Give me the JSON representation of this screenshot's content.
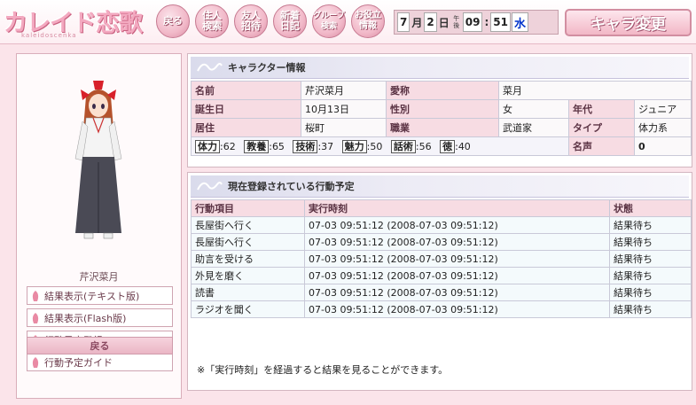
{
  "header": {
    "logo_title": "カレイド恋歌",
    "logo_subtitle": "kaleidoscenka",
    "nav": [
      {
        "label": "戻る"
      },
      {
        "label": "住人\n検索"
      },
      {
        "label": "友人\n招待"
      },
      {
        "label": "新着\n日記"
      },
      {
        "label": "グループ\n検索"
      },
      {
        "label": "お役立\n情報"
      }
    ],
    "clock": {
      "month": "7",
      "month_unit": "月",
      "day": "2",
      "day_unit": "日",
      "ampm": "午後",
      "hour": "09",
      "minute": "51",
      "weekday": "水"
    },
    "change_chara_label": "キャラ変更"
  },
  "sidebar": {
    "character_name": "芹沢菜月",
    "menu": [
      {
        "label": "結果表示(テキスト版)"
      },
      {
        "label": "結果表示(Flash版)"
      },
      {
        "label": "行動予定登録"
      },
      {
        "label": "行動予定ガイド"
      }
    ],
    "back_label": "戻る"
  },
  "info": {
    "title": "キャラクター情報",
    "rows": [
      [
        {
          "label": "名前"
        },
        {
          "value": "芹沢菜月"
        },
        {
          "label": "愛称"
        },
        {
          "value": "菜月"
        }
      ],
      [
        {
          "label": "誕生日"
        },
        {
          "value": "10月13日"
        },
        {
          "label": "性別"
        },
        {
          "value": "女"
        },
        {
          "label": "年代"
        },
        {
          "value": "ジュニア"
        }
      ],
      [
        {
          "label": "居住"
        },
        {
          "value": "桜町"
        },
        {
          "label": "職業"
        },
        {
          "value": "武道家"
        },
        {
          "label": "タイプ"
        },
        {
          "value": "体力系"
        }
      ]
    ],
    "stats": [
      {
        "label": "体力",
        "value": "62"
      },
      {
        "label": "教養",
        "value": "65"
      },
      {
        "label": "技術",
        "value": "37"
      },
      {
        "label": "魅力",
        "value": "50"
      },
      {
        "label": "話術",
        "value": "56"
      },
      {
        "label": "徳",
        "value": "40"
      }
    ],
    "fame_label": "名声",
    "fame_value": "0"
  },
  "schedule": {
    "title": "現在登録されている行動予定",
    "columns": [
      "行動項目",
      "実行時刻",
      "状態"
    ],
    "rows": [
      [
        "長屋街へ行く",
        "07-03 09:51:12 (2008-07-03 09:51:12)",
        "結果待ち"
      ],
      [
        "長屋街へ行く",
        "07-03 09:51:12 (2008-07-03 09:51:12)",
        "結果待ち"
      ],
      [
        "助言を受ける",
        "07-03 09:51:12 (2008-07-03 09:51:12)",
        "結果待ち"
      ],
      [
        "外見を磨く",
        "07-03 09:51:12 (2008-07-03 09:51:12)",
        "結果待ち"
      ],
      [
        "読書",
        "07-03 09:51:12 (2008-07-03 09:51:12)",
        "結果待ち"
      ],
      [
        "ラジオを聞く",
        "07-03 09:51:12 (2008-07-03 09:51:12)",
        "結果待ち"
      ]
    ],
    "note": "※「実行時刻」を経過すると結果を見ることができます。"
  }
}
